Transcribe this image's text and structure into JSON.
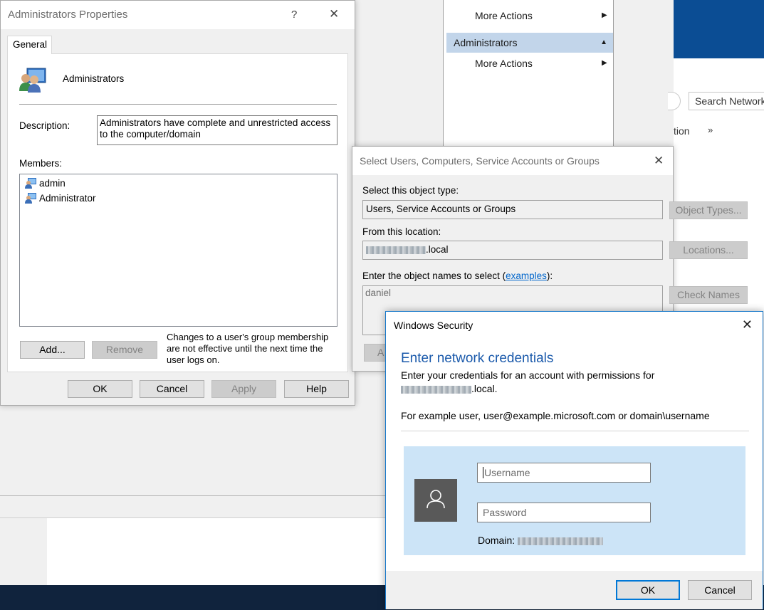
{
  "background": {
    "actions_pane": {
      "item1": "More Actions",
      "header": "Administrators",
      "item2": "More Actions"
    },
    "search_placeholder": "Search Network",
    "tab_fragment": "tion",
    "more_chevron": "»"
  },
  "props": {
    "title": "Administrators Properties",
    "help_glyph": "?",
    "close_glyph": "✕",
    "tab": "General",
    "group_name": "Administrators",
    "description_label": "Description:",
    "description_line1": "Administrators have complete and unrestricted access",
    "description_line2": "to the computer/domain",
    "members_label": "Members:",
    "members": [
      "admin",
      "Administrator"
    ],
    "add_btn": "Add...",
    "remove_btn": "Remove",
    "note_line1": "Changes to a user's group membership",
    "note_line2": "are not effective until the next time the",
    "note_line3": "user logs on.",
    "ok_btn": "OK",
    "cancel_btn": "Cancel",
    "apply_btn": "Apply",
    "help_btn": "Help"
  },
  "select": {
    "title": "Select Users, Computers, Service Accounts or Groups",
    "close_glyph": "✕",
    "object_type_label": "Select this object type:",
    "object_type_value": "Users, Service Accounts or Groups",
    "object_types_btn": "Object Types...",
    "location_label": "From this location:",
    "location_suffix": ".local",
    "locations_btn": "Locations...",
    "names_label_prefix": "Enter the object names to select (",
    "names_label_link": "examples",
    "names_label_suffix": "):",
    "names_value": "daniel",
    "check_names_btn": "Check Names",
    "advanced_fragment": "A"
  },
  "security": {
    "title": "Windows Security",
    "close_glyph": "✕",
    "heading": "Enter network credentials",
    "text_line1": "Enter your credentials for an account with permissions for",
    "domain_suffix": ".local.",
    "example_text": "For example user, user@example.microsoft.com or domain\\username",
    "username_placeholder": "Username",
    "password_placeholder": "Password",
    "domain_label": "Domain:",
    "ok_btn": "OK",
    "cancel_btn": "Cancel"
  }
}
